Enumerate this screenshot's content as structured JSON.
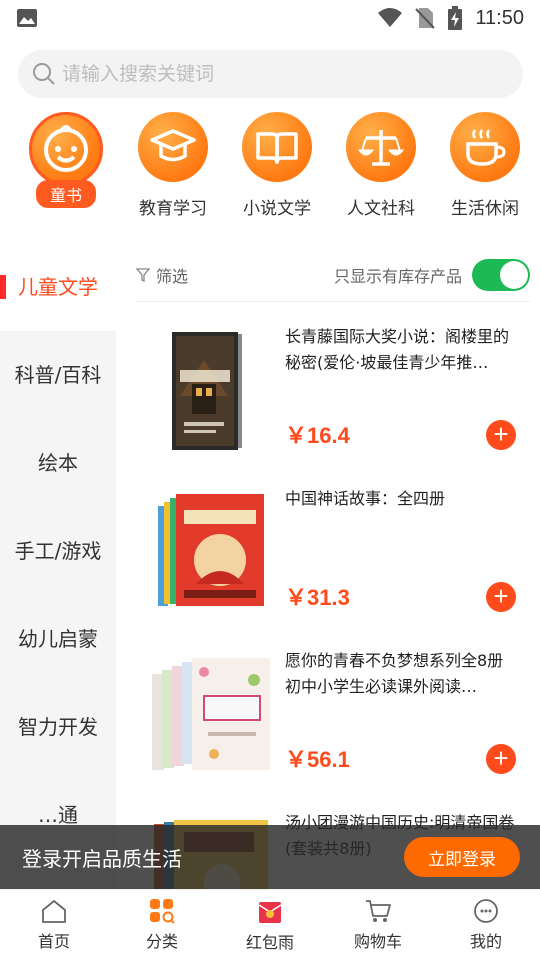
{
  "status_bar": {
    "time": "11:50"
  },
  "search": {
    "placeholder": "请输入搜索关键词"
  },
  "top_categories": [
    {
      "label": "童书",
      "icon": "baby-face-icon",
      "selected": true
    },
    {
      "label": "教育学习",
      "icon": "graduation-cap-icon"
    },
    {
      "label": "小说文学",
      "icon": "open-book-icon"
    },
    {
      "label": "人文社科",
      "icon": "balance-scale-icon"
    },
    {
      "label": "生活休闲",
      "icon": "coffee-cup-icon"
    }
  ],
  "sidebar": {
    "items": [
      {
        "label": "儿童文学",
        "active": true
      },
      {
        "label": "科普/百科"
      },
      {
        "label": "绘本"
      },
      {
        "label": "手工/游戏"
      },
      {
        "label": "幼儿启蒙"
      },
      {
        "label": "智力开发"
      },
      {
        "label": "…通"
      }
    ]
  },
  "filter": {
    "label": "筛选",
    "stock_only_label": "只显示有库存产品",
    "stock_only": true
  },
  "products": [
    {
      "title": "长青藤国际大奖小说：阁楼里的秘密(爱伦·坡最佳青少年推…",
      "price": "￥16.4"
    },
    {
      "title": "中国神话故事：全四册",
      "price": "￥31.3"
    },
    {
      "title": "愿你的青春不负梦想系列全8册 初中小学生必读课外阅读…",
      "price": "￥56.1"
    },
    {
      "title": "汤小团漫游中国历史:明清帝国卷(套装共8册)",
      "price": ""
    }
  ],
  "login_banner": {
    "text": "登录开启品质生活",
    "button": "立即登录"
  },
  "bottom_nav": [
    {
      "label": "首页",
      "icon": "home-icon"
    },
    {
      "label": "分类",
      "icon": "category-grid-icon",
      "active": true
    },
    {
      "label": "红包雨",
      "icon": "red-envelope-icon"
    },
    {
      "label": "购物车",
      "icon": "shopping-cart-icon"
    },
    {
      "label": "我的",
      "icon": "profile-icon"
    }
  ],
  "colors": {
    "accent": "#ff4a1c",
    "toggle_on": "#1db954",
    "category_orange": "#ff8a1e"
  }
}
